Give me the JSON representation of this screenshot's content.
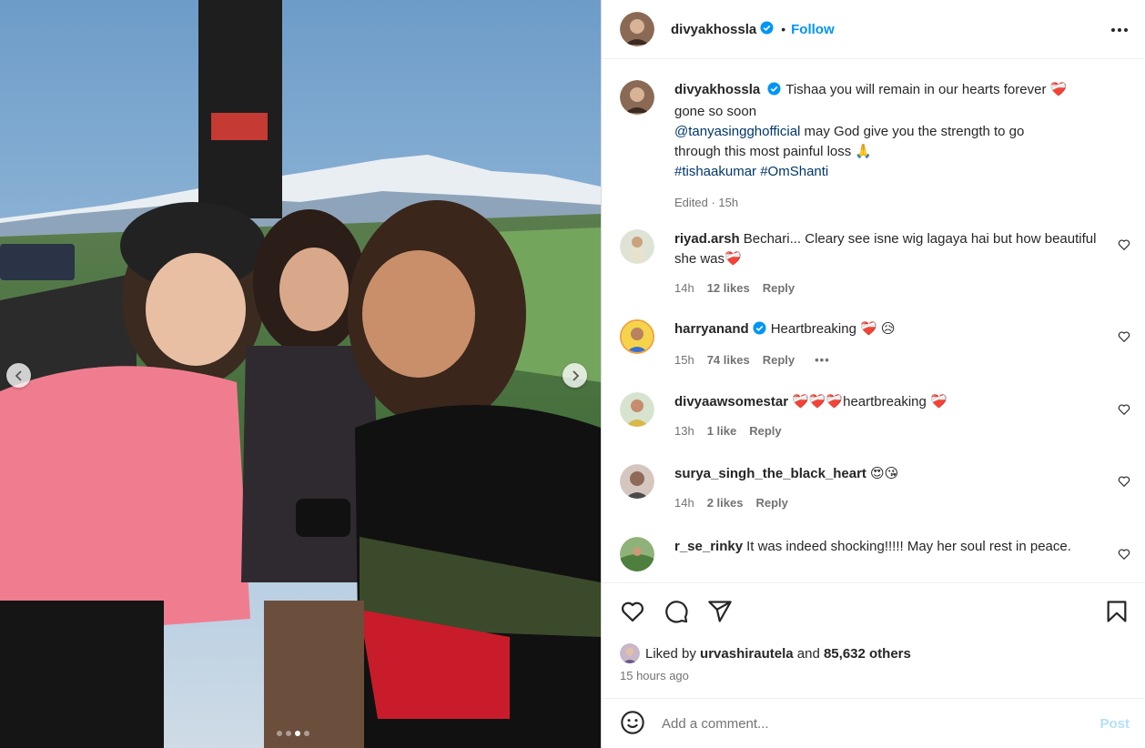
{
  "post": {
    "author": "divyakhossla",
    "follow_label": "Follow",
    "separator": "•",
    "more_icon": "more-horizontal-icon"
  },
  "caption": {
    "username": "divyakhossla",
    "line1": "Tishaa you will remain in our hearts forever ❤️‍🩹",
    "line2": "gone so soon",
    "mention": "@tanyasingghofficial",
    "line3_rest": " may God give you the strength to go",
    "line4": "through this most painful loss 🙏",
    "hashtags": "#tishaakumar #OmShanti",
    "meta": "Edited · 15h"
  },
  "comments": [
    {
      "username": "riyad.arsh",
      "text": "Bechari... Cleary see isne wig lagaya hai but how beautiful she was❤️‍🩹",
      "time": "14h",
      "likes": "12 likes",
      "reply": "Reply"
    },
    {
      "username": "harryanand",
      "text": "Heartbreaking ❤️‍🩹 😥",
      "time": "15h",
      "likes": "74 likes",
      "reply": "Reply",
      "extra": "•••"
    },
    {
      "username": "divyaawsomestar",
      "text": "❤️‍🩹❤️‍🩹❤️‍🩹heartbreaking ❤️‍🩹",
      "time": "13h",
      "likes": "1 like",
      "reply": "Reply"
    },
    {
      "username": "surya_singh_the_black_heart",
      "text": "😍😘",
      "time": "14h",
      "likes": "2 likes",
      "reply": "Reply"
    },
    {
      "username": "r_se_rinky",
      "text": "It was indeed shocking!!!!! May her soul rest in peace."
    }
  ],
  "likes": {
    "prefix": "Liked by",
    "user": "urvashirautela",
    "and": "and",
    "others": "85,632 others"
  },
  "timestamp": "15 hours ago",
  "composer": {
    "placeholder": "Add a comment...",
    "post_label": "Post"
  },
  "carousel": {
    "total_slides": 4,
    "active_slide": 3
  },
  "colors": {
    "accent": "#0095f6",
    "link": "#00376b",
    "muted": "#737373",
    "post_disabled": "#b2dffc",
    "verified": "#0095f6"
  }
}
